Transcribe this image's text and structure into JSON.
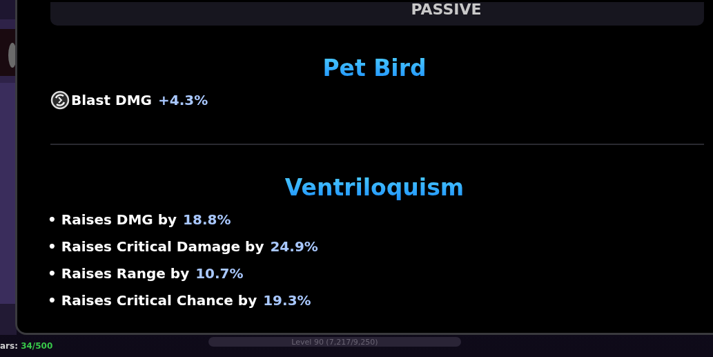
{
  "header": {
    "title": "PASSIVE"
  },
  "sections": [
    {
      "title": "Pet Bird",
      "kind": "icon-stats",
      "stats": [
        {
          "label": "Blast DMG",
          "value": "+4.3%"
        }
      ]
    },
    {
      "title": "Ventriloquism",
      "kind": "bullets",
      "stats": [
        {
          "label": "• Raises DMG by",
          "value": "18.8%"
        },
        {
          "label": "• Raises Critical Damage by",
          "value": "24.9%"
        },
        {
          "label": "• Raises Range by",
          "value": "10.7%"
        },
        {
          "label": "• Raises Critical Chance by",
          "value": "19.3%"
        }
      ]
    }
  ],
  "footer": {
    "counter_label": "ars:",
    "counter_value": "34/500",
    "level_text": "Level 90 (7,217/9,250)"
  }
}
